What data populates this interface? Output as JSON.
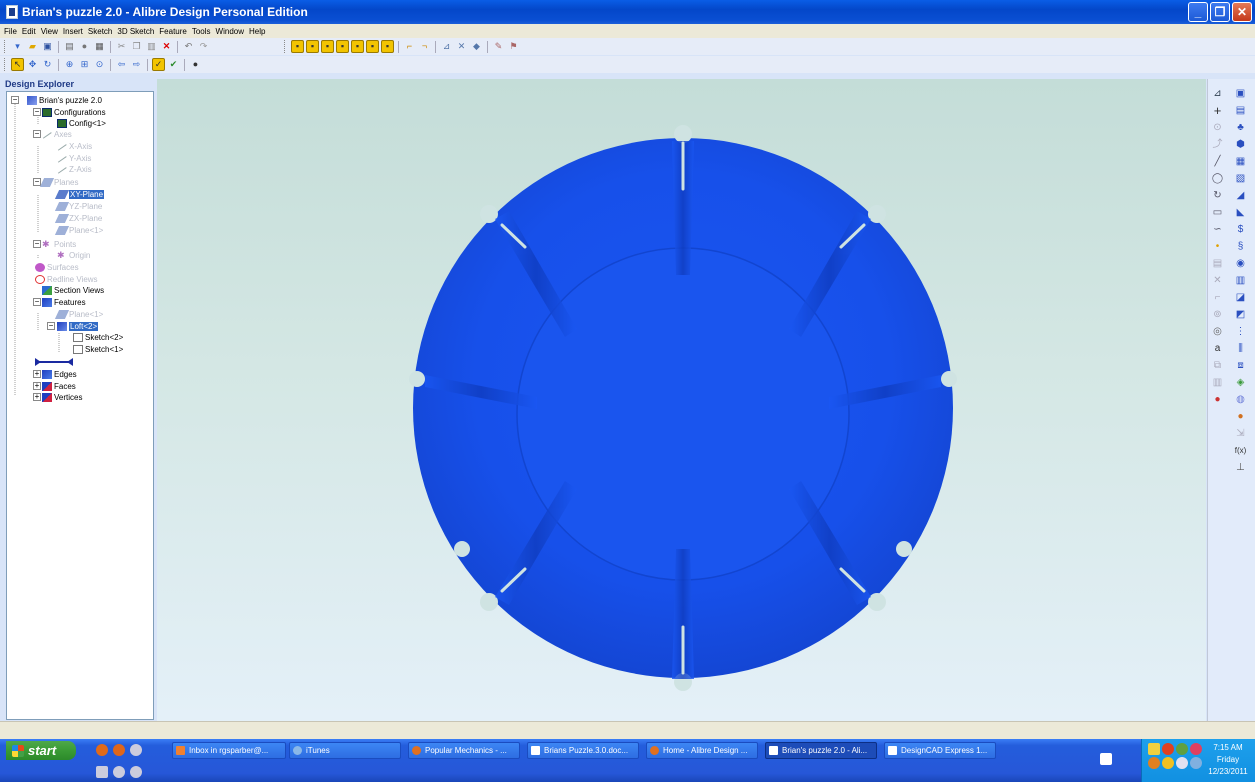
{
  "window": {
    "title": "Brian's puzzle 2.0 - Alibre Design Personal Edition",
    "colors": {
      "titlebar": "#0a4fd3",
      "model": "#1752ea",
      "selection": "#316ac5"
    }
  },
  "menu": [
    "File",
    "Edit",
    "View",
    "Insert",
    "Sketch",
    "3D Sketch",
    "Feature",
    "Tools",
    "Window",
    "Help"
  ],
  "explorer": {
    "title": "Design Explorer",
    "tree": [
      {
        "label": "Brian's puzzle 2.0",
        "icon": "part-icon",
        "dim": false,
        "selected": false
      },
      {
        "label": "Configurations",
        "icon": "configurations-icon",
        "dim": false,
        "selected": false
      },
      {
        "label": "Config<1>",
        "icon": "config-icon",
        "dim": false,
        "selected": false
      },
      {
        "label": "Axes",
        "icon": "axis-icon",
        "dim": true,
        "selected": false
      },
      {
        "label": "X-Axis",
        "icon": "axis-icon",
        "dim": true,
        "selected": false
      },
      {
        "label": "Y-Axis",
        "icon": "axis-icon",
        "dim": true,
        "selected": false
      },
      {
        "label": "Z-Axis",
        "icon": "axis-icon",
        "dim": true,
        "selected": false
      },
      {
        "label": "Planes",
        "icon": "plane-icon",
        "dim": true,
        "selected": false
      },
      {
        "label": "XY-Plane",
        "icon": "plane-icon",
        "dim": false,
        "selected": true
      },
      {
        "label": "YZ-Plane",
        "icon": "plane-icon",
        "dim": true,
        "selected": false
      },
      {
        "label": "ZX-Plane",
        "icon": "plane-icon",
        "dim": true,
        "selected": false
      },
      {
        "label": "Plane<1>",
        "icon": "plane-icon",
        "dim": true,
        "selected": false
      },
      {
        "label": "Points",
        "icon": "point-icon",
        "dim": true,
        "selected": false
      },
      {
        "label": "Origin",
        "icon": "point-icon",
        "dim": true,
        "selected": false
      },
      {
        "label": "Surfaces",
        "icon": "surface-icon",
        "dim": true,
        "selected": false
      },
      {
        "label": "Redline Views",
        "icon": "redline-icon",
        "dim": true,
        "selected": false
      },
      {
        "label": "Section Views",
        "icon": "section-icon",
        "dim": false,
        "selected": false
      },
      {
        "label": "Features",
        "icon": "features-icon",
        "dim": false,
        "selected": false
      },
      {
        "label": "Plane<1>",
        "icon": "plane-icon",
        "dim": true,
        "selected": false
      },
      {
        "label": "Loft<2>",
        "icon": "loft-icon",
        "dim": false,
        "selected": true
      },
      {
        "label": "Sketch<2>",
        "icon": "sketch-icon",
        "dim": false,
        "selected": false
      },
      {
        "label": "Sketch<1>",
        "icon": "sketch-icon",
        "dim": false,
        "selected": false
      },
      {
        "label": "",
        "icon": "rollback-bar-icon",
        "dim": false,
        "selected": false
      },
      {
        "label": "Edges",
        "icon": "edges-icon",
        "dim": false,
        "selected": false
      },
      {
        "label": "Faces",
        "icon": "faces-icon",
        "dim": false,
        "selected": false
      },
      {
        "label": "Vertices",
        "icon": "vertices-icon",
        "dim": false,
        "selected": false
      }
    ]
  },
  "taskbar": {
    "start_label": "start",
    "tasks": [
      {
        "label": "Inbox in rgsparber@...",
        "icon": "mail-icon",
        "active": false
      },
      {
        "label": "iTunes",
        "icon": "itunes-icon",
        "active": false
      },
      {
        "label": "Popular Mechanics - ...",
        "icon": "firefox-icon",
        "active": false
      },
      {
        "label": "Brians Puzzle.3.0.doc...",
        "icon": "word-icon",
        "active": false
      },
      {
        "label": "Home - Alibre Design ...",
        "icon": "browser-icon",
        "active": false
      },
      {
        "label": "Brian's puzzle 2.0 - Ali...",
        "icon": "alibre-icon",
        "active": true
      },
      {
        "label": "DesignCAD Express 1...",
        "icon": "designcad-icon",
        "active": false
      }
    ],
    "clock": {
      "time": "7:15 AM",
      "day": "Friday",
      "date": "12/23/2011"
    }
  }
}
